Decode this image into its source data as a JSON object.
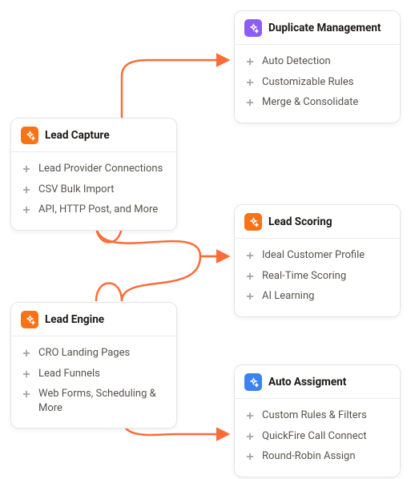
{
  "colors": {
    "arrow": "#fa6c38",
    "icon_orange": "#f97316",
    "icon_purple": "#8b5cf6",
    "icon_blue": "#3b82f6"
  },
  "cards": {
    "lead_capture": {
      "title": "Lead Capture",
      "icon": "sparkle-icon",
      "icon_color": "orange",
      "items": [
        "Lead Provider Connections",
        "CSV Bulk Import",
        "API, HTTP Post, and More"
      ]
    },
    "lead_engine": {
      "title": "Lead Engine",
      "icon": "sparkle-icon",
      "icon_color": "orange",
      "items": [
        "CRO Landing Pages",
        "Lead Funnels",
        "Web Forms, Scheduling & More"
      ]
    },
    "duplicate_management": {
      "title": "Duplicate Management",
      "icon": "sparkle-icon",
      "icon_color": "purple",
      "items": [
        "Auto Detection",
        "Customizable Rules",
        "Merge & Consolidate"
      ]
    },
    "lead_scoring": {
      "title": "Lead Scoring",
      "icon": "sparkle-icon",
      "icon_color": "orange",
      "items": [
        "Ideal Customer Profile",
        "Real-Time Scoring",
        "AI Learning"
      ]
    },
    "auto_assignment": {
      "title": "Auto Assigment",
      "icon": "sparkle-icon",
      "icon_color": "blue",
      "items": [
        "Custom Rules & Filters",
        "QuickFire Call Connect",
        "Round-Robin Assign"
      ]
    }
  }
}
